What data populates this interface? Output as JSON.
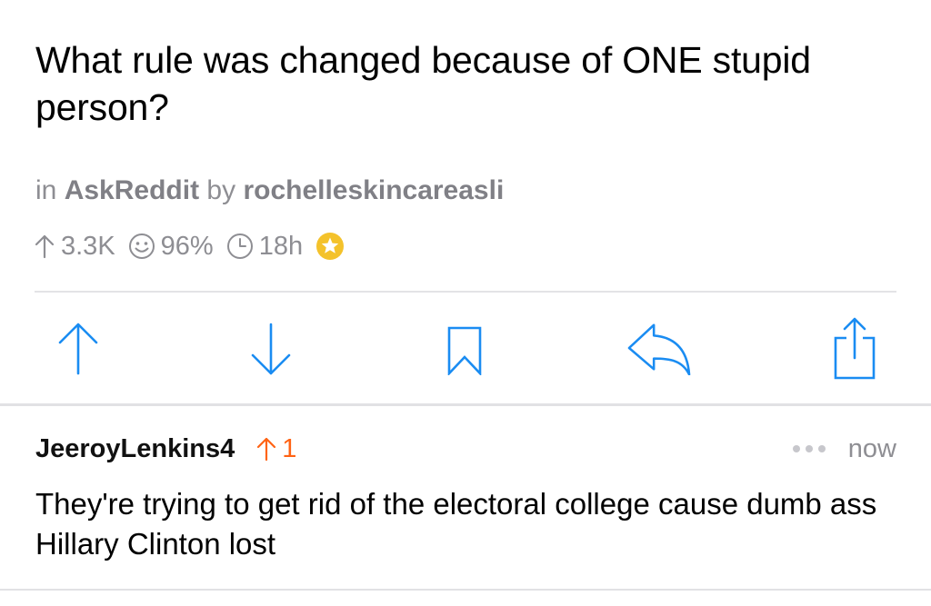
{
  "post": {
    "title": "What rule was changed because of ONE stupid person?",
    "in_word": "in",
    "subreddit": "AskReddit",
    "by_word": "by",
    "author": "rochelleskincareasli",
    "upvotes": "3.3K",
    "upvote_ratio": "96%",
    "age": "18h",
    "gilded": true
  },
  "actions": {
    "upvote_icon": "up-arrow-icon",
    "downvote_icon": "down-arrow-icon",
    "save_icon": "bookmark-icon",
    "reply_icon": "reply-icon",
    "share_icon": "share-icon"
  },
  "comment": {
    "author": "JeeroyLenkins4",
    "score": "1",
    "time": "now",
    "body": "They're trying to get rid of the electoral college cause dumb ass Hillary Clinton lost"
  },
  "colors": {
    "accent_blue": "#1a8cf2",
    "upvote_orange": "#ff6314",
    "meta_gray": "#8e8e93",
    "gold": "#f4c22b"
  }
}
